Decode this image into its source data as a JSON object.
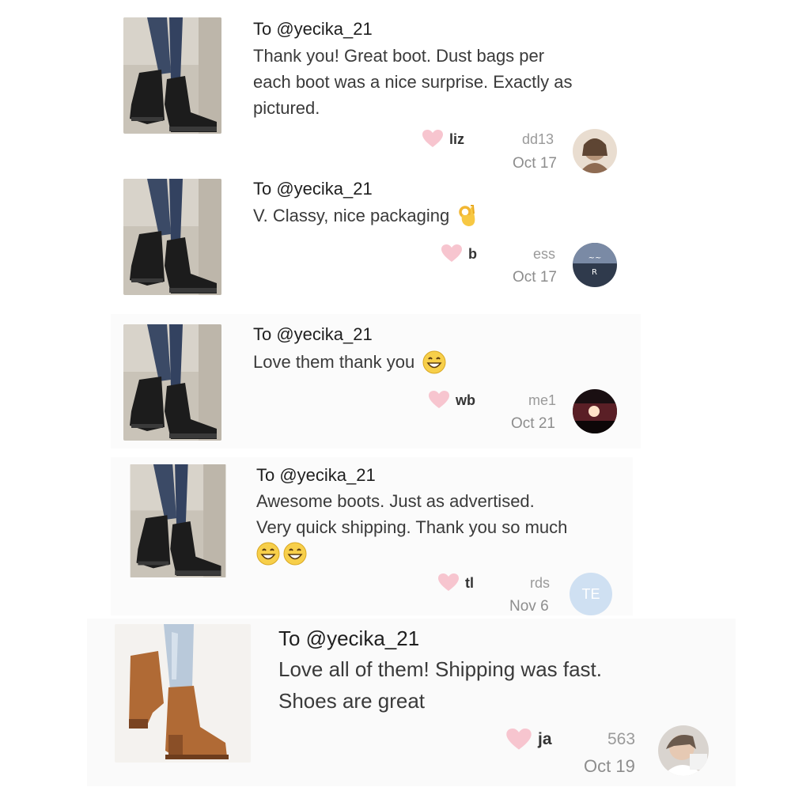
{
  "reviews": [
    {
      "to": "To @yecika_21",
      "message_lines": [
        "Thank you! Great boot. Dust bags per",
        "each boot was a nice surprise. Exactly as",
        "pictured."
      ],
      "emoji": [],
      "user_start": "liz",
      "user_end": "dd13",
      "date": "Oct 17",
      "boot_color": "#1c1c1c",
      "avatar_icon": "photo-avatar-icon"
    },
    {
      "to": "To @yecika_21",
      "message_lines": [
        "V. Classy, nice packaging"
      ],
      "emoji": [
        "ok-hand-emoji"
      ],
      "user_start": "b",
      "user_end": "ess",
      "date": "Oct 17",
      "boot_color": "#1c1c1c",
      "avatar_icon": "logo-avatar-icon"
    },
    {
      "to": "To @yecika_21",
      "message_lines": [
        "Love them thank you"
      ],
      "emoji": [
        "grinning-face-emoji"
      ],
      "user_start": "wb",
      "user_end": "me1",
      "date": "Oct 21",
      "boot_color": "#1c1c1c",
      "avatar_icon": "sunset-avatar-icon"
    },
    {
      "to": "To @yecika_21",
      "message_lines": [
        "Awesome boots. Just as advertised.",
        "Very quick shipping. Thank you so much"
      ],
      "emoji": [
        "grinning-face-emoji",
        "grinning-face-emoji"
      ],
      "user_start": "tl",
      "user_end": "rds",
      "date": "Nov 6",
      "boot_color": "#1c1c1c",
      "avatar_icon": "initials-avatar-icon",
      "avatar_text": "TE"
    },
    {
      "to": "To @yecika_21",
      "message_lines": [
        "Love all of them! Shipping was fast.",
        "Shoes are great"
      ],
      "emoji": [],
      "user_start": "ja",
      "user_end": "563",
      "date": "Oct 19",
      "boot_color": "#b06a35",
      "avatar_icon": "photo-avatar-icon"
    }
  ],
  "colors": {
    "heart": "#f7c5cf",
    "date": "#8d8d8d",
    "text": "#3a3a3a"
  }
}
